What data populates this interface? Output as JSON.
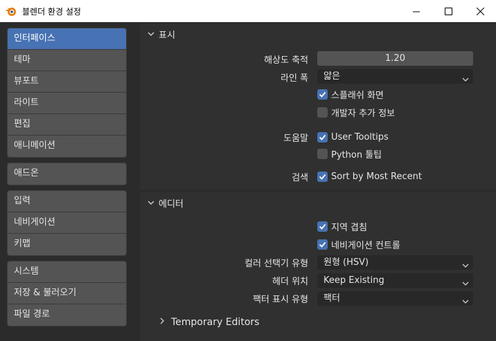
{
  "window": {
    "title": "블렌더 환경 설정",
    "minimize_glyph": "—",
    "maximize_glyph": "☐",
    "close_glyph": "✕"
  },
  "sidebar": {
    "groups": [
      {
        "items": [
          "인터페이스",
          "테마",
          "뷰포트",
          "라이트",
          "편집",
          "애니메이션"
        ],
        "active_index": 0
      },
      {
        "items": [
          "애드온"
        ]
      },
      {
        "items": [
          "입력",
          "네비게이션",
          "키맵"
        ]
      },
      {
        "items": [
          "시스템",
          "저장 & 불러오기",
          "파일 경로"
        ]
      }
    ]
  },
  "display": {
    "title": "표시",
    "resolution_label": "해상도 축적",
    "resolution_value": "1.20",
    "line_width_label": "라인 폭",
    "line_width_value": "얇은",
    "splash_label": "스플래쉬 화면",
    "splash_checked": true,
    "developer_label": "개발자 추가 정보",
    "developer_checked": false,
    "help_label": "도움말",
    "tooltips_label": "User Tooltips",
    "tooltips_checked": true,
    "python_tooltips_label": "Python 툴팁",
    "python_tooltips_checked": false,
    "search_label": "검색",
    "sort_recent_label": "Sort by Most Recent",
    "sort_recent_checked": true
  },
  "editors": {
    "title": "에디터",
    "region_overlap_label": "지역 겹침",
    "region_overlap_checked": true,
    "nav_controls_label": "네비게이션 컨트롤",
    "nav_controls_checked": true,
    "color_picker_label": "컬러 선택기 유형",
    "color_picker_value": "원형 (HSV)",
    "header_pos_label": "헤더 위치",
    "header_pos_value": "Keep Existing",
    "factor_display_label": "팩터 표시 유형",
    "factor_display_value": "팩터",
    "temp_editors_label": "Temporary Editors"
  },
  "colors": {
    "accent": "#4772b3",
    "panel": "#303030",
    "background": "#2b2b2b",
    "nav_item": "#545454"
  }
}
